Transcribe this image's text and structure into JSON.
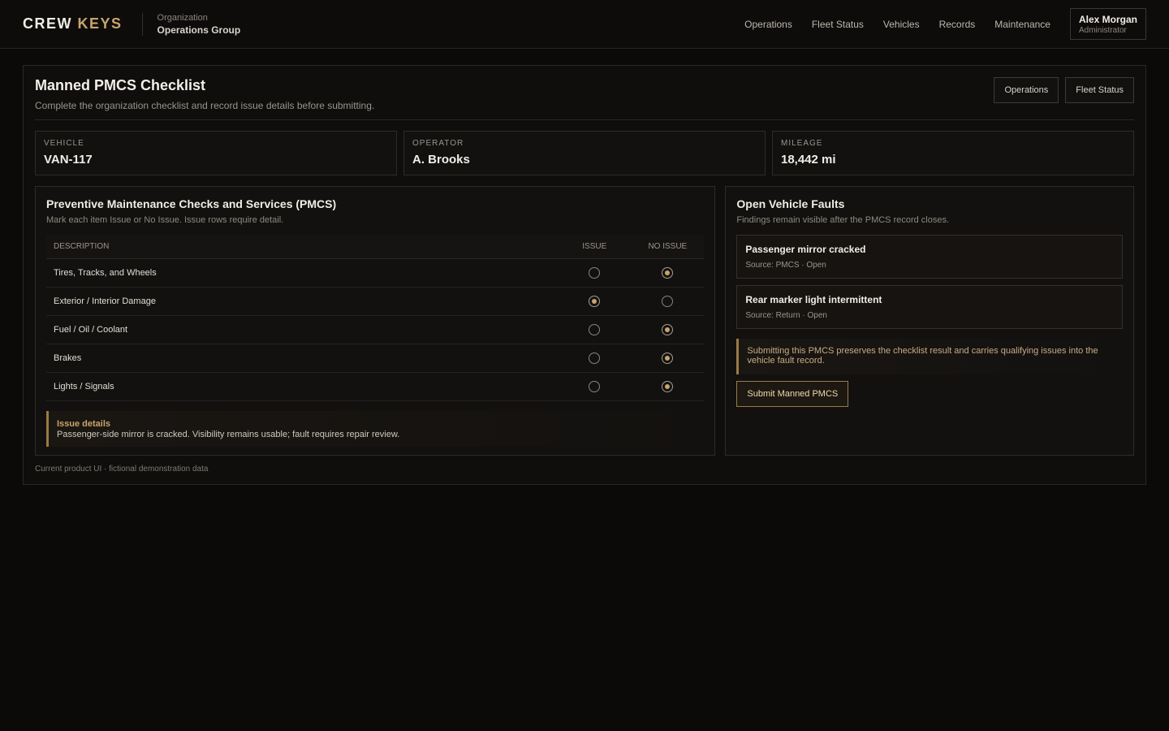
{
  "brand": {
    "part1": "CREW",
    "part2": "KEYS"
  },
  "org": {
    "label": "Organization",
    "name": "Operations Group"
  },
  "nav": [
    "Operations",
    "Fleet Status",
    "Vehicles",
    "Records",
    "Maintenance"
  ],
  "user": {
    "name": "Alex Morgan",
    "role": "Administrator"
  },
  "page": {
    "title": "Manned PMCS Checklist",
    "subtitle": "Complete the organization checklist and record issue details before submitting.",
    "buttons": [
      "Operations",
      "Fleet Status"
    ]
  },
  "stats": [
    {
      "label": "VEHICLE",
      "value": "VAN-117"
    },
    {
      "label": "OPERATOR",
      "value": "A. Brooks"
    },
    {
      "label": "MILEAGE",
      "value": "18,442 mi"
    }
  ],
  "checklist": {
    "title": "Preventive Maintenance Checks and Services (PMCS)",
    "subtitle": "Mark each item Issue or No Issue. Issue rows require detail.",
    "headers": {
      "description": "DESCRIPTION",
      "issue": "ISSUE",
      "no_issue": "NO ISSUE"
    },
    "rows": [
      {
        "description": "Tires, Tracks, and Wheels",
        "status": "no_issue"
      },
      {
        "description": "Exterior / Interior Damage",
        "status": "issue"
      },
      {
        "description": "Fuel / Oil / Coolant",
        "status": "no_issue"
      },
      {
        "description": "Brakes",
        "status": "no_issue"
      },
      {
        "description": "Lights / Signals",
        "status": "no_issue"
      }
    ],
    "issue_details": {
      "title": "Issue details",
      "text": "Passenger-side mirror is cracked. Visibility remains usable; fault requires repair review."
    }
  },
  "faults": {
    "title": "Open Vehicle Faults",
    "subtitle": "Findings remain visible after the PMCS record closes.",
    "items": [
      {
        "title": "Passenger mirror cracked",
        "meta": "Source: PMCS · Open"
      },
      {
        "title": "Rear marker light intermittent",
        "meta": "Source: Return · Open"
      }
    ],
    "note": "Submitting this PMCS preserves the checklist result and carries qualifying issues into the vehicle fault record.",
    "submit_label": "Submit Manned PMCS"
  },
  "footer": "Current product UI · fictional demonstration data",
  "colors": {
    "accent": "#c9a46b",
    "background": "#0b0a09"
  }
}
